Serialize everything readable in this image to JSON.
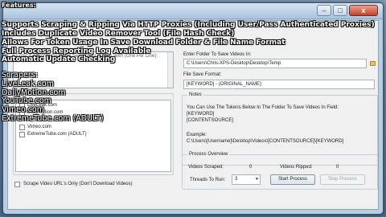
{
  "window": {
    "controls": {
      "minimize": "–",
      "maximize": "□",
      "close": "x"
    }
  },
  "left_panel": {
    "search_placeholder": "Enter Keywords Below To Search For Videos With (One Per Line):",
    "sources_label": "Video Sources:",
    "sources": [
      {
        "label": "LiveLeak.com",
        "checked": false
      },
      {
        "label": "DailyMotion.com",
        "checked": false
      },
      {
        "label": "Vimeo.com",
        "checked": false
      },
      {
        "label": "ExtremeTube.com (ADULT)",
        "checked": false
      }
    ],
    "scrape_only_label": "Scrape Video URL's Only (Don't Download Videos)"
  },
  "right_panel": {
    "folder_label": "Enter Folder To Save Videos In:",
    "folder_value": "C:\\Users\\Chris-XPS-Desktop\\Desktop\\Temp",
    "format_label": "File Save Format:",
    "format_value": "[KEYWORD] - (ORIGINAL_NAME)",
    "notes": {
      "title": "Notes",
      "line1": "You Can Use The Tokens Below In The Folder To Save Videos In Field:",
      "token1": "[KEYWORD]",
      "token2": "[CONTENTSOURCE]",
      "example_label": "Example:",
      "example_value": "C:\\Users\\[Username]\\Desktop\\Videos\\[CONTENTSOURCE]\\[KEYWORD]"
    },
    "process": {
      "title": "Process Overview",
      "scraped_label": "Videos Scraped:",
      "scraped_value": "0",
      "ripped_label": "Videos Ripped:",
      "ripped_value": "0",
      "threads_label": "Threads To Run:",
      "threads_value": "3",
      "start_label": "Start Process",
      "stop_label": "Stop Process"
    }
  },
  "overlay_lines": [
    "Features:",
    "Supports Scraping & Ripping Via HTTP Proxies (Including User/Pass Authenticated Proxies)",
    "Includes Duplicate Video Remover Tool (File Hash Check)",
    "Allows For Token Usage In Save Download Folder & File Name Format",
    "Full Process Reporting Log Available",
    "Automatic Update Checking"
  ],
  "overlay_scrapers": [
    "Scrapers:",
    "LiveLeak.com",
    "DailyMotion.com",
    "YouTube.com",
    "Vimeo.com",
    "ExtremeTube.com (ADULT)"
  ]
}
